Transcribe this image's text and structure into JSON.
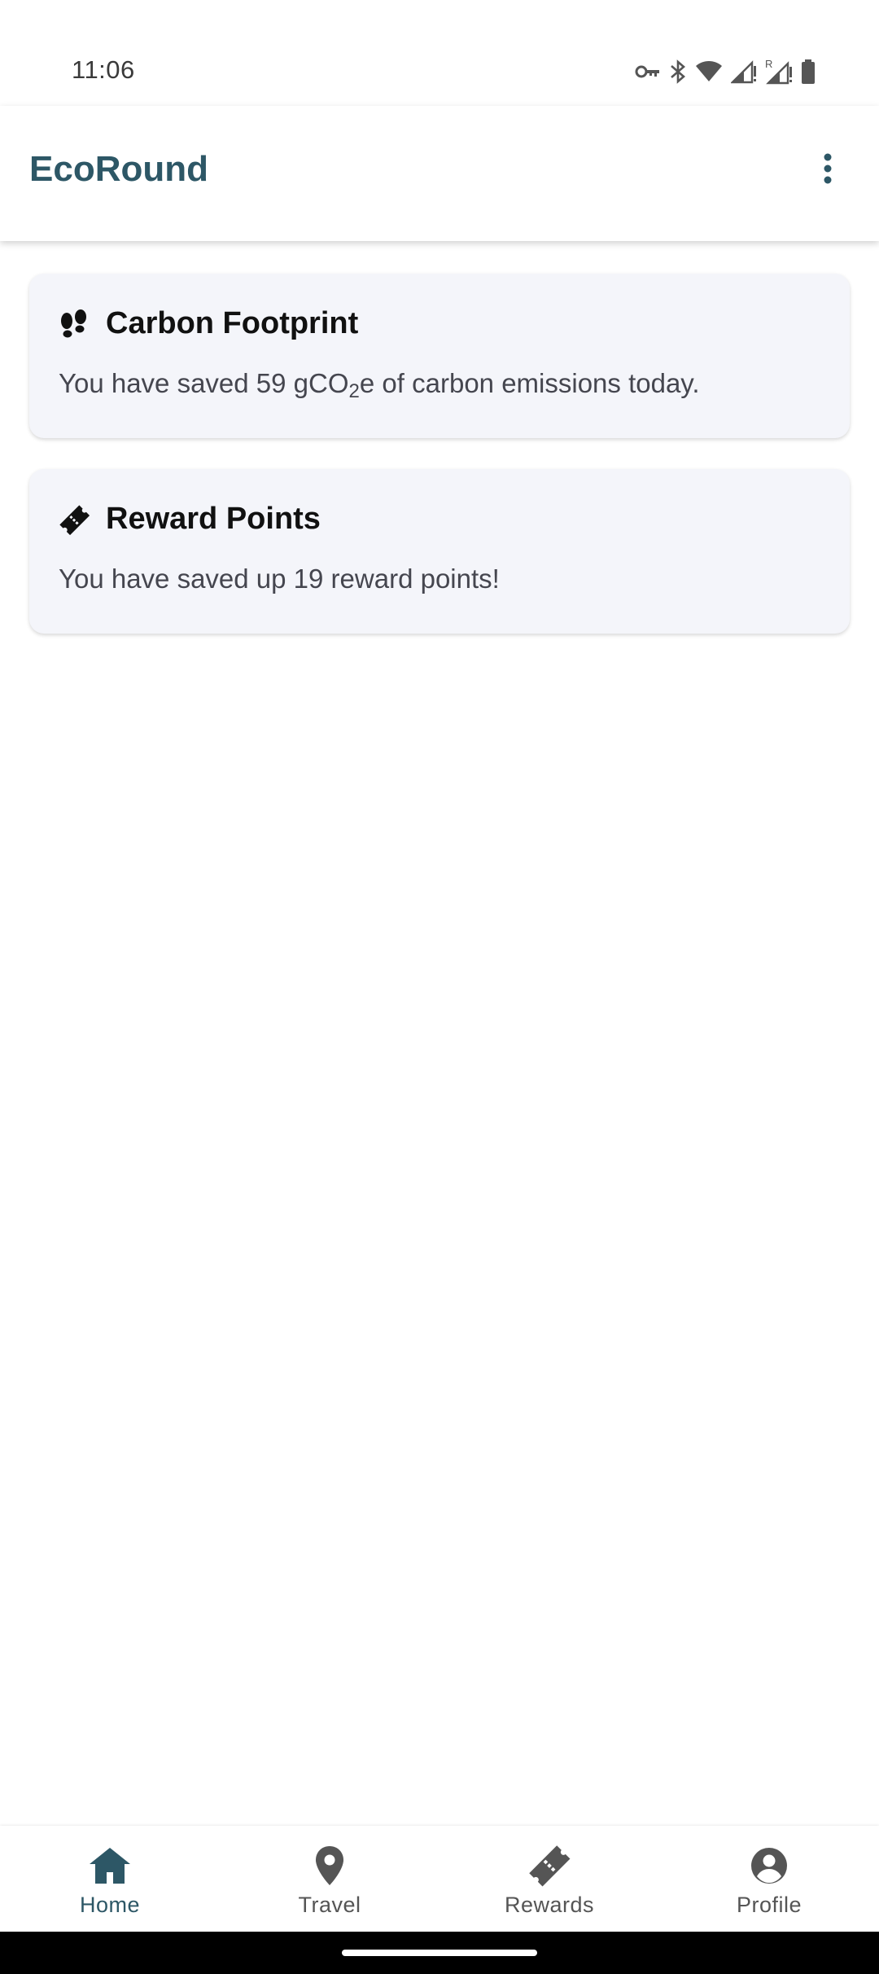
{
  "status_bar": {
    "time": "11:06",
    "icons": [
      "vpn-key-icon",
      "bluetooth-icon",
      "wifi-icon",
      "signal-icon",
      "signal-roaming-icon",
      "battery-icon"
    ]
  },
  "app_bar": {
    "title": "EcoRound",
    "menu_icon": "more-vertical-icon"
  },
  "cards": [
    {
      "icon": "footprints-icon",
      "title": "Carbon Footprint",
      "text_before": "You have saved 59 gCO",
      "subscript": "2",
      "text_after": "e of carbon emissions today."
    },
    {
      "icon": "ticket-icon",
      "title": "Reward Points",
      "text": "You have saved up 19 reward points!"
    }
  ],
  "bottom_nav": {
    "items": [
      {
        "label": "Home",
        "icon": "home-icon",
        "active": true
      },
      {
        "label": "Travel",
        "icon": "location-pin-icon",
        "active": false
      },
      {
        "label": "Rewards",
        "icon": "ticket-icon",
        "active": false
      },
      {
        "label": "Profile",
        "icon": "account-circle-icon",
        "active": false
      }
    ]
  },
  "colors": {
    "accent": "#2d5766",
    "card_bg": "#f4f5fa",
    "inactive": "#555555"
  }
}
